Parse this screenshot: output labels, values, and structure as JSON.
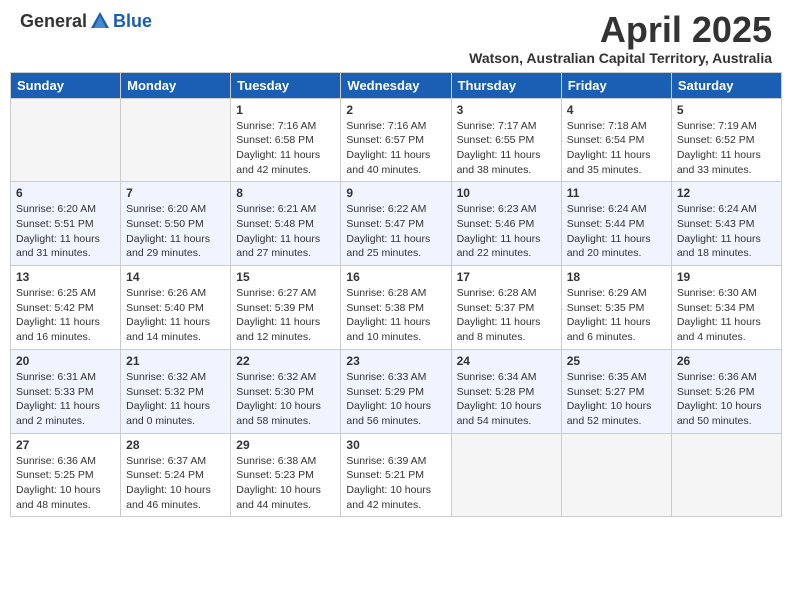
{
  "header": {
    "logo_general": "General",
    "logo_blue": "Blue",
    "month": "April 2025",
    "location": "Watson, Australian Capital Territory, Australia"
  },
  "days_of_week": [
    "Sunday",
    "Monday",
    "Tuesday",
    "Wednesday",
    "Thursday",
    "Friday",
    "Saturday"
  ],
  "weeks": [
    [
      {
        "day": "",
        "info": ""
      },
      {
        "day": "",
        "info": ""
      },
      {
        "day": "1",
        "info": "Sunrise: 7:16 AM\nSunset: 6:58 PM\nDaylight: 11 hours and 42 minutes."
      },
      {
        "day": "2",
        "info": "Sunrise: 7:16 AM\nSunset: 6:57 PM\nDaylight: 11 hours and 40 minutes."
      },
      {
        "day": "3",
        "info": "Sunrise: 7:17 AM\nSunset: 6:55 PM\nDaylight: 11 hours and 38 minutes."
      },
      {
        "day": "4",
        "info": "Sunrise: 7:18 AM\nSunset: 6:54 PM\nDaylight: 11 hours and 35 minutes."
      },
      {
        "day": "5",
        "info": "Sunrise: 7:19 AM\nSunset: 6:52 PM\nDaylight: 11 hours and 33 minutes."
      }
    ],
    [
      {
        "day": "6",
        "info": "Sunrise: 6:20 AM\nSunset: 5:51 PM\nDaylight: 11 hours and 31 minutes."
      },
      {
        "day": "7",
        "info": "Sunrise: 6:20 AM\nSunset: 5:50 PM\nDaylight: 11 hours and 29 minutes."
      },
      {
        "day": "8",
        "info": "Sunrise: 6:21 AM\nSunset: 5:48 PM\nDaylight: 11 hours and 27 minutes."
      },
      {
        "day": "9",
        "info": "Sunrise: 6:22 AM\nSunset: 5:47 PM\nDaylight: 11 hours and 25 minutes."
      },
      {
        "day": "10",
        "info": "Sunrise: 6:23 AM\nSunset: 5:46 PM\nDaylight: 11 hours and 22 minutes."
      },
      {
        "day": "11",
        "info": "Sunrise: 6:24 AM\nSunset: 5:44 PM\nDaylight: 11 hours and 20 minutes."
      },
      {
        "day": "12",
        "info": "Sunrise: 6:24 AM\nSunset: 5:43 PM\nDaylight: 11 hours and 18 minutes."
      }
    ],
    [
      {
        "day": "13",
        "info": "Sunrise: 6:25 AM\nSunset: 5:42 PM\nDaylight: 11 hours and 16 minutes."
      },
      {
        "day": "14",
        "info": "Sunrise: 6:26 AM\nSunset: 5:40 PM\nDaylight: 11 hours and 14 minutes."
      },
      {
        "day": "15",
        "info": "Sunrise: 6:27 AM\nSunset: 5:39 PM\nDaylight: 11 hours and 12 minutes."
      },
      {
        "day": "16",
        "info": "Sunrise: 6:28 AM\nSunset: 5:38 PM\nDaylight: 11 hours and 10 minutes."
      },
      {
        "day": "17",
        "info": "Sunrise: 6:28 AM\nSunset: 5:37 PM\nDaylight: 11 hours and 8 minutes."
      },
      {
        "day": "18",
        "info": "Sunrise: 6:29 AM\nSunset: 5:35 PM\nDaylight: 11 hours and 6 minutes."
      },
      {
        "day": "19",
        "info": "Sunrise: 6:30 AM\nSunset: 5:34 PM\nDaylight: 11 hours and 4 minutes."
      }
    ],
    [
      {
        "day": "20",
        "info": "Sunrise: 6:31 AM\nSunset: 5:33 PM\nDaylight: 11 hours and 2 minutes."
      },
      {
        "day": "21",
        "info": "Sunrise: 6:32 AM\nSunset: 5:32 PM\nDaylight: 11 hours and 0 minutes."
      },
      {
        "day": "22",
        "info": "Sunrise: 6:32 AM\nSunset: 5:30 PM\nDaylight: 10 hours and 58 minutes."
      },
      {
        "day": "23",
        "info": "Sunrise: 6:33 AM\nSunset: 5:29 PM\nDaylight: 10 hours and 56 minutes."
      },
      {
        "day": "24",
        "info": "Sunrise: 6:34 AM\nSunset: 5:28 PM\nDaylight: 10 hours and 54 minutes."
      },
      {
        "day": "25",
        "info": "Sunrise: 6:35 AM\nSunset: 5:27 PM\nDaylight: 10 hours and 52 minutes."
      },
      {
        "day": "26",
        "info": "Sunrise: 6:36 AM\nSunset: 5:26 PM\nDaylight: 10 hours and 50 minutes."
      }
    ],
    [
      {
        "day": "27",
        "info": "Sunrise: 6:36 AM\nSunset: 5:25 PM\nDaylight: 10 hours and 48 minutes."
      },
      {
        "day": "28",
        "info": "Sunrise: 6:37 AM\nSunset: 5:24 PM\nDaylight: 10 hours and 46 minutes."
      },
      {
        "day": "29",
        "info": "Sunrise: 6:38 AM\nSunset: 5:23 PM\nDaylight: 10 hours and 44 minutes."
      },
      {
        "day": "30",
        "info": "Sunrise: 6:39 AM\nSunset: 5:21 PM\nDaylight: 10 hours and 42 minutes."
      },
      {
        "day": "",
        "info": ""
      },
      {
        "day": "",
        "info": ""
      },
      {
        "day": "",
        "info": ""
      }
    ]
  ]
}
